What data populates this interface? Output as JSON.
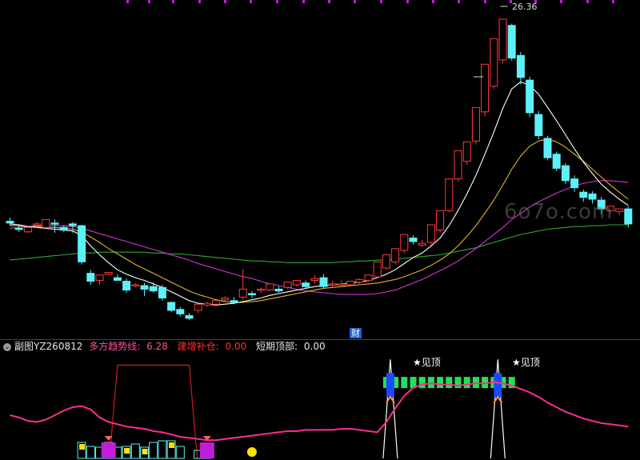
{
  "header": {
    "indicator_name": "副图YZ260812",
    "series": [
      {
        "label": "多方趋势线:",
        "value": "6.28"
      },
      {
        "label": "建增补仓:",
        "value": "0.00"
      },
      {
        "label": "短期顶部:",
        "value": "0.00"
      }
    ]
  },
  "watermark": "6o7o.com",
  "cai_tag": "财",
  "peak_price_label": "26.36",
  "top_signals": [
    {
      "text": "★见顶"
    },
    {
      "text": "★见顶"
    }
  ],
  "colors": {
    "up": "#ff3c3c",
    "down": "#5ef0f8",
    "ma_white": "#ffffff",
    "ma_yellow": "#e6b422",
    "ma_magenta": "#d235d2",
    "ma_green": "#2fa82f",
    "trend_pink": "#ff2d8f",
    "box_red": "#d21a1a",
    "bar_green": "#22e05a",
    "bar_blue": "#1e48ff",
    "bar_purple": "#c21dd8",
    "bar_yellow": "#ffe000"
  },
  "chart_data": {
    "type": "candlestick",
    "candles": [
      [
        4.1,
        4.5,
        3.9,
        3.6,
        "down"
      ],
      [
        3.3,
        3.6,
        3.2,
        2.9,
        "down"
      ],
      [
        2.9,
        3.2,
        3.4,
        2.8,
        "up"
      ],
      [
        3.7,
        4.0,
        3.8,
        3.3,
        "up"
      ],
      [
        3.4,
        3.6,
        4.3,
        3.2,
        "up"
      ],
      [
        3.9,
        4.3,
        3.8,
        2.8,
        "down"
      ],
      [
        3.4,
        3.6,
        3.1,
        2.9,
        "down"
      ],
      [
        3.8,
        4.0,
        3.6,
        2.8,
        "down"
      ],
      [
        3.6,
        3.7,
        -0.5,
        -0.8,
        "down"
      ],
      [
        -1.8,
        -1.4,
        -2.7,
        -3.1,
        "down"
      ],
      [
        -2.6,
        -2.2,
        -2.0,
        -3.1,
        "up"
      ],
      [
        -1.9,
        -1.7,
        -1.7,
        -2.0,
        "up"
      ],
      [
        -2.3,
        -1.9,
        -2.6,
        -2.6,
        "down"
      ],
      [
        -2.7,
        -2.4,
        -3.7,
        -4.0,
        "down"
      ],
      [
        -3.2,
        -2.9,
        -3.1,
        -3.4,
        "up"
      ],
      [
        -3.2,
        -2.9,
        -3.6,
        -4.4,
        "down"
      ],
      [
        -3.3,
        -2.8,
        -3.8,
        -4.0,
        "down"
      ],
      [
        -3.4,
        -3.1,
        -4.6,
        -4.9,
        "down"
      ],
      [
        -5.1,
        -5.0,
        -6.0,
        -6.2,
        "down"
      ],
      [
        -5.9,
        -5.6,
        -6.4,
        -6.7,
        "down"
      ],
      [
        -6.6,
        -6.3,
        -6.9,
        -7.1,
        "down"
      ],
      [
        -6.0,
        -5.6,
        -5.3,
        -6.3,
        "up"
      ],
      [
        -5.4,
        -5.0,
        -5.2,
        -5.6,
        "up"
      ],
      [
        -5.3,
        -5.0,
        -4.9,
        -5.3,
        "up"
      ],
      [
        -4.8,
        -4.4,
        -4.6,
        -5.0,
        "up"
      ],
      [
        -4.9,
        -4.5,
        -5.1,
        -5.3,
        "down"
      ],
      [
        -4.5,
        -1.3,
        -3.6,
        -4.8,
        "up"
      ],
      [
        -4.1,
        -3.8,
        -4.2,
        -4.6,
        "down"
      ],
      [
        -3.7,
        -3.4,
        -3.6,
        -4.0,
        "up"
      ],
      [
        -3.7,
        -3.4,
        -3.0,
        -3.8,
        "up"
      ],
      [
        -3.6,
        -3.3,
        -3.8,
        -4.0,
        "down"
      ],
      [
        -3.4,
        -2.9,
        -2.8,
        -3.6,
        "up"
      ],
      [
        -3.1,
        -2.6,
        -2.6,
        -3.3,
        "up"
      ],
      [
        -2.9,
        -2.6,
        -3.3,
        -3.5,
        "down"
      ],
      [
        -2.6,
        -2.0,
        -2.4,
        -3.0,
        "up"
      ],
      [
        -2.3,
        -1.9,
        -3.3,
        -3.5,
        "down"
      ],
      [
        -3.0,
        -2.6,
        -3.0,
        -3.4,
        "up"
      ],
      [
        -3.0,
        -2.6,
        -3.1,
        -3.3,
        "up"
      ],
      [
        -3.1,
        -2.7,
        -2.7,
        -3.3,
        "up"
      ],
      [
        -2.8,
        -2.4,
        -2.5,
        -3.0,
        "up"
      ],
      [
        -2.6,
        -2.2,
        -2.0,
        -2.8,
        "up"
      ],
      [
        -2.2,
        -1.8,
        -0.5,
        -2.4,
        "up"
      ],
      [
        -1.2,
        -0.9,
        0.3,
        -1.4,
        "up"
      ],
      [
        -0.5,
        -0.2,
        1.0,
        -0.8,
        "up"
      ],
      [
        0.8,
        1.0,
        2.6,
        0.5,
        "up"
      ],
      [
        2.2,
        2.5,
        1.8,
        1.5,
        "down"
      ],
      [
        1.6,
        2.0,
        1.4,
        1.2,
        "up"
      ],
      [
        1.7,
        2.1,
        3.7,
        1.4,
        "up"
      ],
      [
        3.1,
        3.4,
        5.3,
        2.8,
        "up"
      ],
      [
        5.3,
        5.6,
        8.9,
        5.1,
        "up"
      ],
      [
        8.9,
        9.3,
        12.1,
        8.6,
        "up"
      ],
      [
        10.9,
        11.2,
        13.1,
        10.5,
        "up"
      ],
      [
        13.2,
        13.4,
        17.0,
        12.8,
        "up"
      ],
      [
        16.5,
        16.8,
        21.9,
        16.0,
        "up"
      ],
      [
        19.4,
        19.7,
        24.8,
        19.1,
        "up"
      ],
      [
        22.4,
        22.7,
        27.0,
        22.0,
        "up"
      ],
      [
        26.3,
        26.5,
        22.6,
        22.3,
        "down"
      ],
      [
        22.9,
        23.3,
        20.4,
        19.6,
        "down"
      ],
      [
        20.1,
        20.5,
        16.4,
        15.9,
        "down"
      ],
      [
        16.2,
        16.6,
        13.8,
        13.4,
        "down"
      ],
      [
        13.5,
        13.8,
        11.3,
        11.0,
        "down"
      ],
      [
        11.7,
        12.0,
        10.1,
        9.8,
        "down"
      ],
      [
        10.4,
        10.7,
        8.7,
        8.3,
        "down"
      ],
      [
        8.9,
        9.3,
        7.9,
        7.4,
        "down"
      ],
      [
        7.4,
        7.7,
        6.8,
        6.3,
        "down"
      ],
      [
        7.2,
        7.5,
        6.6,
        6.1,
        "down"
      ],
      [
        6.5,
        6.9,
        5.5,
        4.9,
        "down"
      ],
      [
        5.3,
        5.5,
        5.8,
        5.0,
        "up"
      ],
      [
        5.2,
        5.5,
        5.5,
        4.8,
        "up"
      ],
      [
        5.5,
        5.8,
        3.8,
        3.4,
        "down"
      ]
    ],
    "ma_white": [
      3.8,
      3.7,
      3.5,
      3.4,
      3.3,
      3.2,
      3.1,
      3.0,
      2.5,
      1.3,
      0.3,
      -0.6,
      -1.4,
      -1.9,
      -2.3,
      -2.6,
      -3.0,
      -3.4,
      -3.9,
      -4.4,
      -4.9,
      -5.2,
      -5.3,
      -5.4,
      -5.3,
      -5.2,
      -5.0,
      -4.8,
      -4.6,
      -4.3,
      -4.1,
      -3.9,
      -3.7,
      -3.5,
      -3.3,
      -3.2,
      -3.1,
      -3.0,
      -2.9,
      -2.8,
      -2.6,
      -2.3,
      -1.9,
      -1.4,
      -0.7,
      0.0,
      0.5,
      1.3,
      2.2,
      3.6,
      5.3,
      7.2,
      9.3,
      11.7,
      14.2,
      16.9,
      19.1,
      19.9,
      19.5,
      18.5,
      17.0,
      15.5,
      13.9,
      12.3,
      10.8,
      9.5,
      8.3,
      7.4,
      6.6,
      5.9
    ],
    "ma_yellow": [
      3.6,
      3.6,
      3.5,
      3.5,
      3.4,
      3.4,
      3.3,
      3.2,
      2.9,
      2.3,
      1.7,
      1.0,
      0.4,
      -0.2,
      -0.8,
      -1.3,
      -1.8,
      -2.3,
      -2.8,
      -3.3,
      -3.8,
      -4.2,
      -4.5,
      -4.8,
      -5.0,
      -5.1,
      -5.1,
      -5.0,
      -4.9,
      -4.7,
      -4.5,
      -4.3,
      -4.1,
      -3.9,
      -3.7,
      -3.5,
      -3.4,
      -3.3,
      -3.2,
      -3.1,
      -3.0,
      -2.9,
      -2.7,
      -2.5,
      -2.2,
      -1.8,
      -1.4,
      -0.9,
      -0.3,
      0.4,
      1.3,
      2.4,
      3.6,
      5.0,
      6.5,
      8.2,
      10.0,
      11.5,
      12.6,
      13.2,
      13.4,
      13.1,
      12.5,
      11.7,
      10.9,
      10.0,
      9.1,
      8.2,
      7.4,
      6.6
    ],
    "ma_magenta": [
      3.3,
      3.4,
      3.5,
      3.6,
      3.6,
      3.6,
      3.6,
      3.5,
      3.3,
      3.0,
      2.7,
      2.4,
      2.1,
      1.8,
      1.5,
      1.2,
      0.9,
      0.6,
      0.3,
      0.0,
      -0.3,
      -0.7,
      -1.0,
      -1.3,
      -1.6,
      -1.9,
      -2.2,
      -2.4,
      -2.7,
      -3.0,
      -3.2,
      -3.4,
      -3.6,
      -3.8,
      -3.9,
      -4.0,
      -4.1,
      -4.2,
      -4.2,
      -4.2,
      -4.2,
      -4.1,
      -3.9,
      -3.7,
      -3.3,
      -2.9,
      -2.5,
      -2.0,
      -1.5,
      -1.0,
      -0.4,
      0.3,
      1.0,
      1.8,
      2.6,
      3.4,
      4.3,
      5.0,
      5.7,
      6.3,
      6.8,
      7.3,
      7.7,
      8.1,
      8.4,
      8.6,
      8.7,
      8.7,
      8.6,
      8.5
    ],
    "ma_green": [
      -0.3,
      -0.2,
      -0.1,
      0.0,
      0.1,
      0.2,
      0.3,
      0.4,
      0.5,
      0.5,
      0.6,
      0.6,
      0.6,
      0.6,
      0.6,
      0.6,
      0.5,
      0.5,
      0.4,
      0.4,
      0.3,
      0.2,
      0.1,
      0.0,
      -0.1,
      -0.2,
      -0.3,
      -0.4,
      -0.4,
      -0.5,
      -0.5,
      -0.6,
      -0.6,
      -0.6,
      -0.6,
      -0.6,
      -0.6,
      -0.5,
      -0.5,
      -0.4,
      -0.4,
      -0.3,
      -0.3,
      -0.2,
      -0.1,
      0.0,
      0.1,
      0.2,
      0.3,
      0.5,
      0.7,
      0.9,
      1.1,
      1.4,
      1.7,
      2.0,
      2.3,
      2.6,
      2.8,
      3.0,
      3.2,
      3.3,
      3.4,
      3.5,
      3.5,
      3.6,
      3.6,
      3.7,
      3.7,
      3.7
    ],
    "peak_index": 55,
    "sub": {
      "trend_line": [
        3.8,
        3.6,
        3.3,
        3.2,
        3.4,
        3.8,
        4.2,
        4.5,
        4.6,
        4.3,
        3.6,
        3.2,
        3.0,
        2.8,
        2.7,
        2.6,
        2.4,
        2.3,
        2.1,
        1.9,
        1.8,
        1.7,
        1.6,
        1.6,
        1.7,
        1.8,
        1.9,
        2.0,
        2.1,
        2.2,
        2.3,
        2.4,
        2.4,
        2.5,
        2.5,
        2.5,
        2.5,
        2.6,
        2.6,
        2.5,
        2.4,
        2.3,
        3.2,
        4.4,
        5.5,
        6.2,
        6.5,
        6.6,
        6.5,
        6.5,
        6.4,
        6.5,
        6.6,
        6.6,
        6.7,
        6.6,
        6.4,
        6.1,
        5.8,
        5.4,
        4.9,
        4.5,
        4.1,
        3.8,
        3.5,
        3.3,
        3.1,
        3.0,
        2.9,
        2.8
      ],
      "red_box": {
        "from": 12,
        "to": 20,
        "level": 8.2
      },
      "top_spikes": [
        42,
        54
      ],
      "green_bars_from": 42,
      "green_bars_to": 56
    }
  }
}
